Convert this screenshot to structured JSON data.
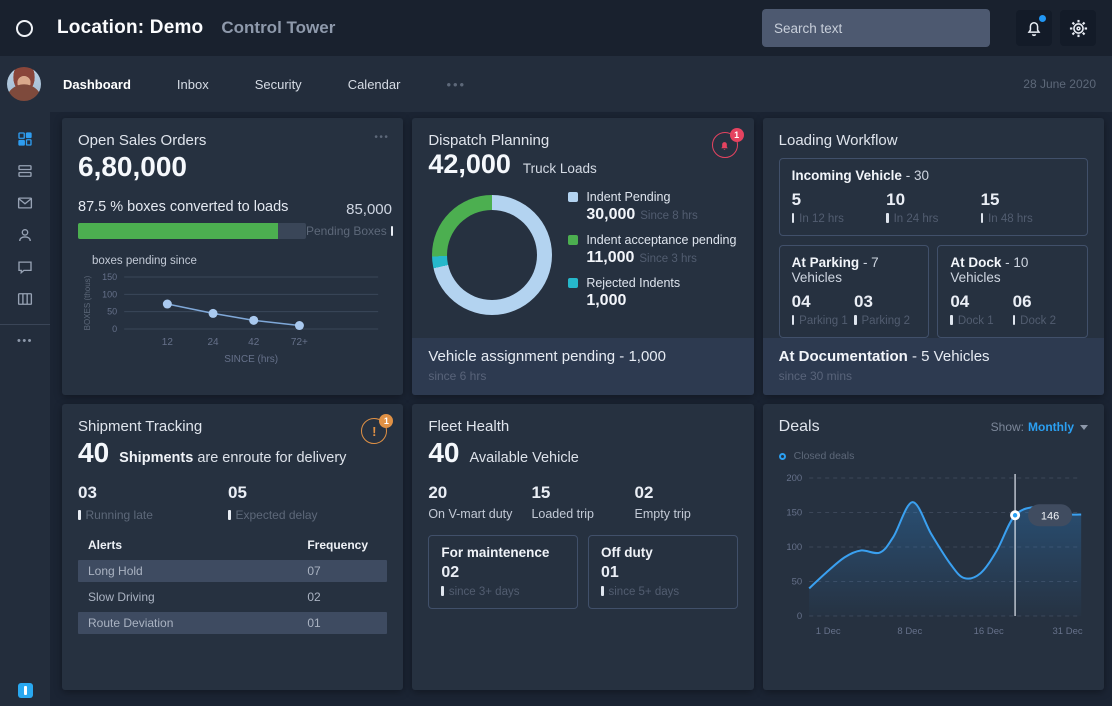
{
  "header": {
    "location_label": "Location: Demo",
    "app_title": "Control Tower",
    "search_placeholder": "Search text",
    "date": "28 June 2020"
  },
  "tabs": [
    {
      "label": "Dashboard"
    },
    {
      "label": "Inbox"
    },
    {
      "label": "Security"
    },
    {
      "label": "Calendar"
    },
    {
      "label": "•••"
    }
  ],
  "sidebar": {
    "more_label": "•••"
  },
  "sales": {
    "title": "Open Sales Orders",
    "menu_label": "•••",
    "value": "6,80,000",
    "converted_label": "87.5 % boxes converted to loads",
    "progress_pct": 87.5,
    "pending_value": "85,000",
    "pending_label": "Pending Boxes"
  },
  "dispatch": {
    "title": "Dispatch Planning",
    "badge": "1",
    "value": "42,000",
    "value_label": "Truck Loads",
    "footer_title": "Vehicle assignment pending - 1,000",
    "footer_since": "since 6 hrs"
  },
  "loading": {
    "title": "Loading Workflow",
    "incoming": {
      "title_bold": "Incoming Vehicle",
      "title_rest": "- 30",
      "cols": [
        {
          "value": "5",
          "label": "In 12 hrs"
        },
        {
          "value": "10",
          "label": "In 24 hrs"
        },
        {
          "value": "15",
          "label": "In 48 hrs"
        }
      ]
    },
    "parking": {
      "title_bold": "At Parking",
      "title_rest": "- 7 Vehicles",
      "cols": [
        {
          "value": "04",
          "label": "Parking 1"
        },
        {
          "value": "03",
          "label": "Parking 2"
        }
      ]
    },
    "dock": {
      "title_bold": "At Dock",
      "title_rest": "- 10 Vehicles",
      "cols": [
        {
          "value": "04",
          "label": "Dock 1"
        },
        {
          "value": "06",
          "label": "Dock 2"
        }
      ]
    },
    "documentation": {
      "title_bold": "At Documentation",
      "title_rest": "- 5 Vehicles",
      "since": "since 30 mins"
    }
  },
  "shipment": {
    "title": "Shipment Tracking",
    "badge": "1",
    "value": "40",
    "subtitle_bold": "Shipments",
    "subtitle_rest": "are enroute for delivery",
    "stats": [
      {
        "value": "03",
        "label": "Running late"
      },
      {
        "value": "05",
        "label": "Expected delay"
      }
    ],
    "alerts": {
      "col1": "Alerts",
      "col2": "Frequency",
      "rows": [
        {
          "name": "Long Hold",
          "freq": "07"
        },
        {
          "name": "Slow Driving",
          "freq": "02"
        },
        {
          "name": "Route Deviation",
          "freq": "01"
        }
      ]
    }
  },
  "fleet": {
    "title": "Fleet Health",
    "value": "40",
    "subtitle": "Available Vehicle",
    "stats": [
      {
        "value": "20",
        "label": "On V-mart duty"
      },
      {
        "value": "15",
        "label": "Loaded trip"
      },
      {
        "value": "02",
        "label": "Empty trip"
      }
    ],
    "boxes": [
      {
        "title": "For maintenence",
        "value": "02",
        "label": "since 3+ days"
      },
      {
        "title": "Off duty",
        "value": "01",
        "label": "since 5+ days"
      }
    ]
  },
  "deals": {
    "title": "Deals",
    "show_label": "Show:",
    "show_value": "Monthly",
    "legend": "Closed deals"
  },
  "colors": {
    "accent_blue": "#2ba0f2",
    "green": "#4caf50",
    "donut_blue": "#b3d3f0",
    "teal": "#26b8cb",
    "crimson": "#e54360",
    "orange": "#e09145"
  },
  "chart_data": [
    {
      "id": "boxes_pending",
      "type": "line",
      "title": "boxes pending since",
      "xlabel": "SINCE (hrs)",
      "ylabel": "BOXES (thous)",
      "categories": [
        "12",
        "24",
        "42",
        "72+"
      ],
      "values": [
        72,
        45,
        25,
        10
      ],
      "ylim": [
        0,
        150
      ],
      "yticks": [
        0,
        50,
        100,
        150
      ],
      "grid": true,
      "line_color": "#7fa8d8",
      "dot_color": "#a9c9ef"
    },
    {
      "id": "dispatch_split",
      "type": "pie",
      "total_display": "42,000",
      "total_label": "Truck Loads",
      "slices": [
        {
          "label": "Indent Pending",
          "value": 30000,
          "display": "30,000",
          "since": "Since 8 hrs",
          "color": "#b3d3f0"
        },
        {
          "label": "Indent acceptance pending",
          "value": 11000,
          "display": "11,000",
          "since": "Since 3 hrs",
          "color": "#4caf50"
        },
        {
          "label": "Rejected Indents",
          "value": 1000,
          "display": "1,000",
          "since": "",
          "color": "#26b8cb"
        }
      ],
      "clockwise_order": [
        0,
        2,
        1
      ]
    },
    {
      "id": "closed_deals",
      "type": "area",
      "legend": "Closed deals",
      "ylim": [
        0,
        200
      ],
      "yticks": [
        0,
        50,
        100,
        150,
        200
      ],
      "grid": "dashed",
      "xticks": [
        "1 Dec",
        "8 Dec",
        "16 Dec",
        "31 Dec"
      ],
      "xtick_fracs": [
        0.07,
        0.37,
        0.66,
        0.95
      ],
      "points": [
        [
          0,
          40
        ],
        [
          0.06,
          62
        ],
        [
          0.13,
          85
        ],
        [
          0.19,
          95
        ],
        [
          0.26,
          92
        ],
        [
          0.31,
          115
        ],
        [
          0.38,
          165
        ],
        [
          0.45,
          118
        ],
        [
          0.52,
          75
        ],
        [
          0.57,
          55
        ],
        [
          0.63,
          62
        ],
        [
          0.69,
          95
        ],
        [
          0.757,
          146
        ],
        [
          0.84,
          158
        ],
        [
          0.92,
          148
        ],
        [
          1,
          147
        ]
      ],
      "highlight": {
        "x": 0.757,
        "value": 146,
        "label": "146"
      },
      "line_color": "#3aa0f0"
    }
  ]
}
